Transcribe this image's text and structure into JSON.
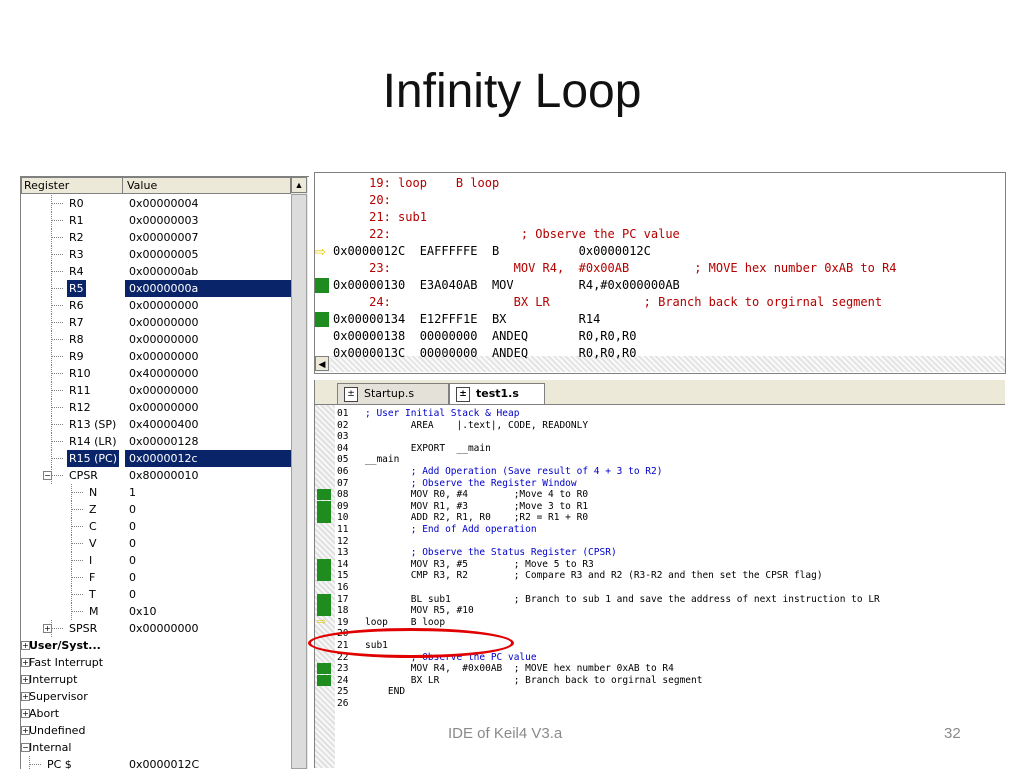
{
  "slide": {
    "title": "Infinity Loop",
    "footer": "IDE of Keil4 V3.a",
    "page_number": "32"
  },
  "registers": {
    "col_register": "Register",
    "col_value": "Value",
    "rows": [
      {
        "name": "R0",
        "value": "0x00000004"
      },
      {
        "name": "R1",
        "value": "0x00000003"
      },
      {
        "name": "R2",
        "value": "0x00000007"
      },
      {
        "name": "R3",
        "value": "0x00000005"
      },
      {
        "name": "R4",
        "value": "0x000000ab"
      },
      {
        "name": "R5",
        "value": "0x0000000a"
      },
      {
        "name": "R6",
        "value": "0x00000000"
      },
      {
        "name": "R7",
        "value": "0x00000000"
      },
      {
        "name": "R8",
        "value": "0x00000000"
      },
      {
        "name": "R9",
        "value": "0x00000000"
      },
      {
        "name": "R10",
        "value": "0x40000000"
      },
      {
        "name": "R11",
        "value": "0x00000000"
      },
      {
        "name": "R12",
        "value": "0x00000000"
      },
      {
        "name": "R13 (SP)",
        "value": "0x40000400"
      },
      {
        "name": "R14 (LR)",
        "value": "0x00000128"
      },
      {
        "name": "R15 (PC)",
        "value": "0x0000012c"
      },
      {
        "name": "CPSR",
        "value": "0x80000010"
      },
      {
        "name": "N",
        "value": "1"
      },
      {
        "name": "Z",
        "value": "0"
      },
      {
        "name": "C",
        "value": "0"
      },
      {
        "name": "V",
        "value": "0"
      },
      {
        "name": "I",
        "value": "0"
      },
      {
        "name": "F",
        "value": "0"
      },
      {
        "name": "T",
        "value": "0"
      },
      {
        "name": "M",
        "value": "0x10"
      },
      {
        "name": "SPSR",
        "value": "0x00000000"
      },
      {
        "name": "User/Syst...",
        "value": ""
      },
      {
        "name": "Fast Interrupt",
        "value": ""
      },
      {
        "name": "Interrupt",
        "value": ""
      },
      {
        "name": "Supervisor",
        "value": ""
      },
      {
        "name": "Abort",
        "value": ""
      },
      {
        "name": "Undefined",
        "value": ""
      },
      {
        "name": "Internal",
        "value": ""
      },
      {
        "name": "PC $",
        "value": "0x0000012C"
      }
    ]
  },
  "disassembly": {
    "lines": [
      "     19: loop    B loop",
      "     20:",
      "     21: sub1",
      "     22:                  ; Observe the PC value",
      "0x0000012C  EAFFFFFE  B           0x0000012C",
      "     23:                 MOV R4,  #0x00AB         ; MOVE hex number 0xAB to R4",
      "0x00000130  E3A040AB  MOV         R4,#0x000000AB",
      "     24:                 BX LR             ; Branch back to orgirnal segment",
      "0x00000134  E12FFF1E  BX          R14",
      "0x00000138  00000000  ANDEQ       R0,R0,R0",
      "0x0000013C  00000000  ANDEQ       R0,R0,R0"
    ]
  },
  "editor": {
    "tabs": [
      "Startup.s",
      "test1.s"
    ],
    "lines": [
      {
        "n": "01",
        "t": "; User Initial Stack & Heap"
      },
      {
        "n": "02",
        "t": "        AREA    |.text|, CODE, READONLY"
      },
      {
        "n": "03",
        "t": ""
      },
      {
        "n": "04",
        "t": "        EXPORT  __main"
      },
      {
        "n": "05",
        "t": "__main"
      },
      {
        "n": "06",
        "t": "        ; Add Operation (Save result of 4 + 3 to R2)"
      },
      {
        "n": "07",
        "t": "        ; Observe the Register Window"
      },
      {
        "n": "08",
        "t": "        MOV R0, #4        ;Move 4 to R0"
      },
      {
        "n": "09",
        "t": "        MOV R1, #3        ;Move 3 to R1"
      },
      {
        "n": "10",
        "t": "        ADD R2, R1, R0    ;R2 = R1 + R0"
      },
      {
        "n": "11",
        "t": "        ; End of Add operation"
      },
      {
        "n": "12",
        "t": ""
      },
      {
        "n": "13",
        "t": "        ; Observe the Status Register (CPSR)"
      },
      {
        "n": "14",
        "t": "        MOV R3, #5        ; Move 5 to R3"
      },
      {
        "n": "15",
        "t": "        CMP R3, R2        ; Compare R3 and R2 (R3-R2 and then set the CPSR flag)"
      },
      {
        "n": "16",
        "t": ""
      },
      {
        "n": "17",
        "t": "        BL sub1           ; Branch to sub 1 and save the address of next instruction to LR"
      },
      {
        "n": "18",
        "t": "        MOV R5, #10"
      },
      {
        "n": "19",
        "t": "loop    B loop"
      },
      {
        "n": "20",
        "t": ""
      },
      {
        "n": "21",
        "t": "sub1"
      },
      {
        "n": "22",
        "t": "        ; Observe the PC value"
      },
      {
        "n": "23",
        "t": "        MOV R4,  #0x00AB  ; MOVE hex number 0xAB to R4"
      },
      {
        "n": "24",
        "t": "        BX LR             ; Branch back to orgirnal segment"
      },
      {
        "n": "25",
        "t": "    END"
      },
      {
        "n": "26",
        "t": ""
      }
    ]
  },
  "colors": {
    "selection": "#0a246a",
    "breakpoint_mark": "#1e8c1e",
    "highlight_oval": "#e00000",
    "source_text": "#b40000",
    "comment": "#0000c8"
  }
}
